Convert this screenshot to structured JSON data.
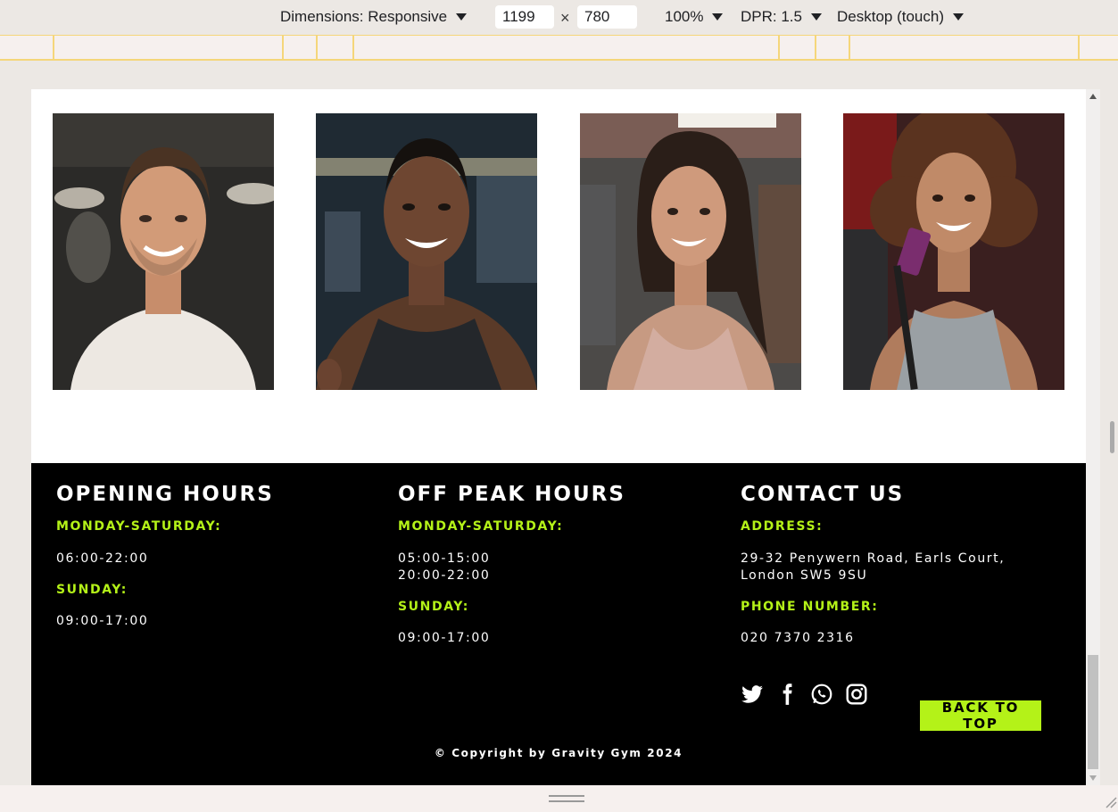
{
  "devtools": {
    "dimensions_label": "Dimensions: Responsive",
    "width_value": "1199",
    "height_value": "780",
    "times_symbol": "×",
    "zoom_label": "100%",
    "dpr_label": "DPR: 1.5",
    "device_mode_label": "Desktop (touch)"
  },
  "team": {
    "photos": [
      {
        "alt": "smiling man in white t-shirt"
      },
      {
        "alt": "smiling man in black tank top"
      },
      {
        "alt": "smiling woman with long curly hair"
      },
      {
        "alt": "smiling woman with curly hair holding phone"
      }
    ]
  },
  "footer": {
    "opening": {
      "title": "OPENING HOURS",
      "weekday_label": "MONDAY-SATURDAY:",
      "weekday_hours": "06:00-22:00",
      "sunday_label": "SUNDAY:",
      "sunday_hours": "09:00-17:00"
    },
    "offpeak": {
      "title": "OFF PEAK HOURS",
      "weekday_label": "MONDAY-SATURDAY:",
      "weekday_hours_1": "05:00-15:00",
      "weekday_hours_2": "20:00-22:00",
      "sunday_label": "SUNDAY:",
      "sunday_hours": "09:00-17:00"
    },
    "contact": {
      "title": "CONTACT US",
      "address_label": "ADDRESS:",
      "address_line_1": "29-32 Penywern Road, Earls Court,",
      "address_line_2": "London SW5 9SU",
      "phone_label": "PHONE NUMBER:",
      "phone": "020 7370 2316",
      "social_icons": [
        "twitter-icon",
        "facebook-icon",
        "whatsapp-icon",
        "instagram-icon"
      ]
    },
    "back_to_top": "BACK TO TOP",
    "copyright": "© Copyright by Gravity Gym 2024"
  },
  "colors": {
    "accent": "#b4f218",
    "footer_bg": "#000000",
    "page_bg": "#ffffff",
    "devtools_bg": "#ece8e4"
  }
}
